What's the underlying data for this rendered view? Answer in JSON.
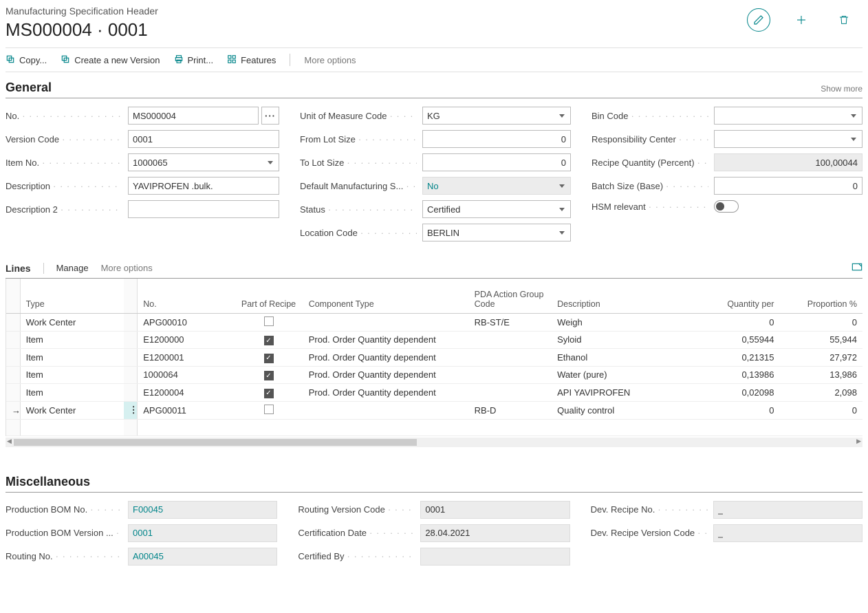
{
  "header": {
    "subtitle": "Manufacturing Specification Header",
    "title": "MS000004 · 0001"
  },
  "toolbar": {
    "copy": "Copy...",
    "create_version": "Create a new Version",
    "print": "Print...",
    "features": "Features",
    "more": "More options"
  },
  "general": {
    "heading": "General",
    "show_more": "Show more",
    "labels": {
      "no": "No.",
      "version_code": "Version Code",
      "item_no": "Item No.",
      "description": "Description",
      "description2": "Description 2",
      "uom": "Unit of Measure Code",
      "from_lot": "From Lot Size",
      "to_lot": "To Lot Size",
      "default_mfg": "Default Manufacturing S...",
      "status": "Status",
      "location": "Location Code",
      "bin": "Bin Code",
      "resp_center": "Responsibility Center",
      "recipe_qty": "Recipe Quantity (Percent)",
      "batch_size": "Batch Size (Base)",
      "hsm": "HSM relevant"
    },
    "values": {
      "no": "MS000004",
      "version_code": "0001",
      "item_no": "1000065",
      "description": "YAVIPROFEN .bulk.",
      "description2": "",
      "uom": "KG",
      "from_lot": "0",
      "to_lot": "0",
      "default_mfg": "No",
      "status": "Certified",
      "location": "BERLIN",
      "bin": "",
      "resp_center": "",
      "recipe_qty": "100,00044",
      "batch_size": "0"
    }
  },
  "lines": {
    "heading": "Lines",
    "manage": "Manage",
    "more": "More options",
    "columns": {
      "type": "Type",
      "no": "No.",
      "part_recipe": "Part of Recipe",
      "component_type": "Component Type",
      "pda_group": "PDA Action Group Code",
      "description": "Description",
      "qty_per": "Quantity per",
      "proportion": "Proportion %"
    },
    "rows": [
      {
        "type": "Work Center",
        "no": "APG00010",
        "recipe": false,
        "comp": "",
        "pda": "RB-ST/E",
        "desc": "Weigh",
        "qty": "0",
        "prop": "0",
        "active": false
      },
      {
        "type": "Item",
        "no": "E1200000",
        "recipe": true,
        "comp": "Prod. Order Quantity dependent",
        "pda": "",
        "desc": "Syloid",
        "qty": "0,55944",
        "prop": "55,944",
        "active": false
      },
      {
        "type": "Item",
        "no": "E1200001",
        "recipe": true,
        "comp": "Prod. Order Quantity dependent",
        "pda": "",
        "desc": "Ethanol",
        "qty": "0,21315",
        "prop": "27,972",
        "active": false
      },
      {
        "type": "Item",
        "no": "1000064",
        "recipe": true,
        "comp": "Prod. Order Quantity dependent",
        "pda": "",
        "desc": "Water (pure)",
        "qty": "0,13986",
        "prop": "13,986",
        "active": false
      },
      {
        "type": "Item",
        "no": "E1200004",
        "recipe": true,
        "comp": "Prod. Order Quantity dependent",
        "pda": "",
        "desc": "API YAVIPROFEN",
        "qty": "0,02098",
        "prop": "2,098",
        "active": false
      },
      {
        "type": "Work Center",
        "no": "APG00011",
        "recipe": false,
        "comp": "",
        "pda": "RB-D",
        "desc": "Quality control",
        "qty": "0",
        "prop": "0",
        "active": true
      }
    ]
  },
  "misc": {
    "heading": "Miscellaneous",
    "labels": {
      "prod_bom_no": "Production BOM No.",
      "prod_bom_ver": "Production BOM Version ...",
      "routing_no": "Routing No.",
      "routing_ver": "Routing Version Code",
      "cert_date": "Certification Date",
      "cert_by": "Certified By",
      "dev_recipe_no": "Dev. Recipe No.",
      "dev_recipe_ver": "Dev. Recipe Version Code"
    },
    "values": {
      "prod_bom_no": "F00045",
      "prod_bom_ver": "0001",
      "routing_no": "A00045",
      "routing_ver": "0001",
      "cert_date": "28.04.2021",
      "cert_by": "",
      "dev_recipe_no": "_",
      "dev_recipe_ver": "_"
    }
  }
}
